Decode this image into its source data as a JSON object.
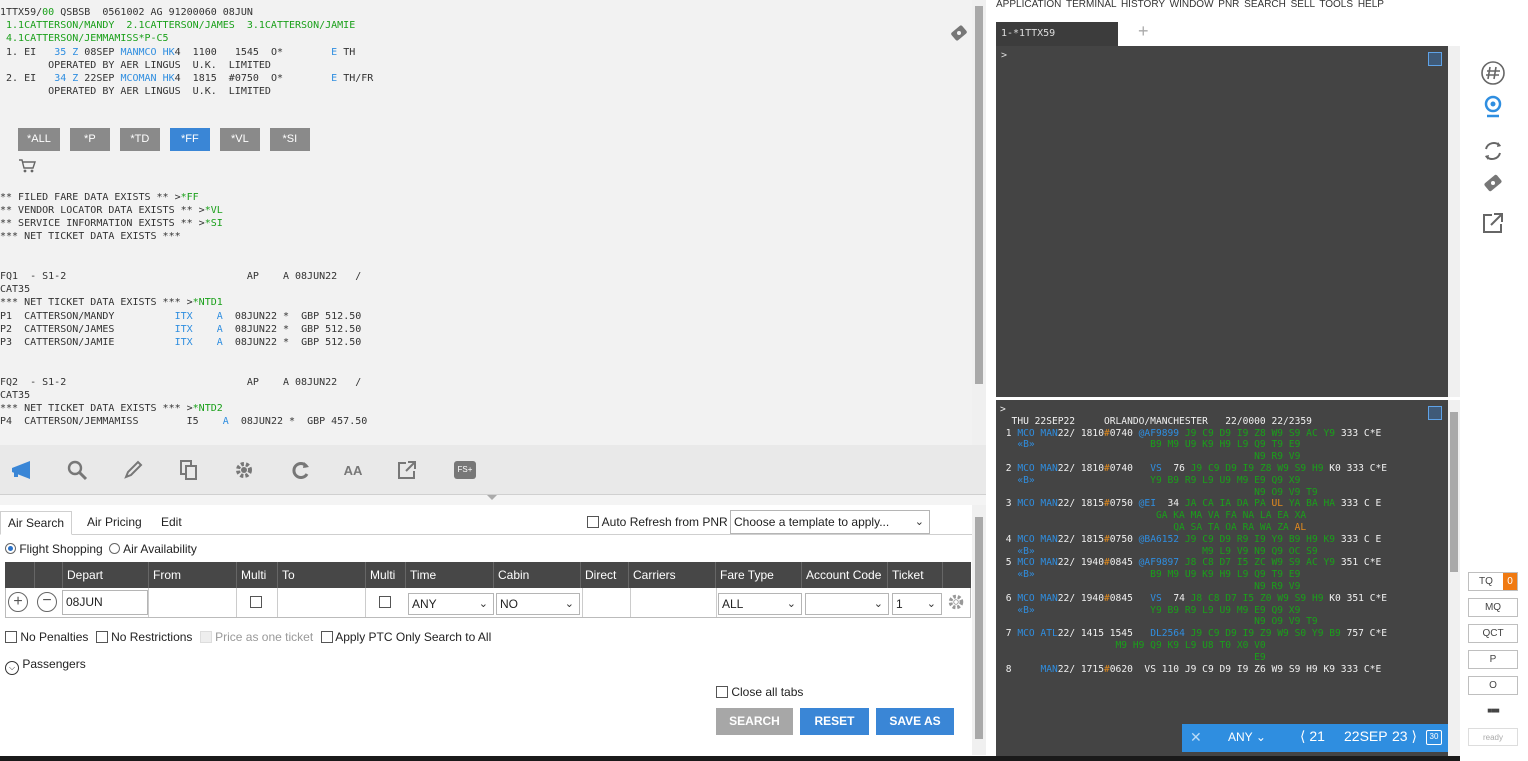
{
  "pnr": {
    "lines": [
      [
        [
          "1TTX59/",
          "d"
        ],
        [
          "00",
          "g"
        ],
        [
          " QSBSB  0561002 AG 91200060 08JUN",
          "d"
        ]
      ],
      [
        [
          " 1.1CATTERSON/MANDY  2.1CATTERSON/JAMES  3.1CATTERSON/JAMIE",
          "g"
        ]
      ],
      [
        [
          " 4.1CATTERSON/JEMMAMISS*P-C5",
          "g"
        ]
      ],
      [
        [
          " 1. EI   ",
          "d"
        ],
        [
          "35 Z",
          "b"
        ],
        [
          " 08SEP ",
          "d"
        ],
        [
          "MANMCO HK",
          "b"
        ],
        [
          "4  1100   1545  O*        ",
          "d"
        ],
        [
          "E",
          "b"
        ],
        [
          " TH",
          "d"
        ]
      ],
      [
        [
          "        OPERATED BY AER LINGUS  U.K.  LIMITED",
          "d"
        ]
      ],
      [
        [
          " 2. EI   ",
          "d"
        ],
        [
          "34 Z",
          "b"
        ],
        [
          " 22SEP ",
          "d"
        ],
        [
          "MCOMAN HK",
          "b"
        ],
        [
          "4  1815  #0750  O*        ",
          "d"
        ],
        [
          "E",
          "b"
        ],
        [
          " TH/FR",
          "d"
        ]
      ],
      [
        [
          "        OPERATED BY AER LINGUS  U.K.  LIMITED",
          "d"
        ]
      ],
      [
        [
          "",
          "d"
        ]
      ],
      [
        [
          "",
          "d"
        ]
      ],
      [
        [
          "",
          "d"
        ]
      ],
      [
        [
          "",
          "d"
        ]
      ],
      [
        [
          "",
          "d"
        ]
      ],
      [
        [
          "",
          "d"
        ]
      ],
      [
        [
          "",
          "d"
        ]
      ],
      [
        [
          "** FILED FARE DATA EXISTS ** >",
          "d"
        ],
        [
          "*FF",
          "g"
        ]
      ],
      [
        [
          "** VENDOR LOCATOR DATA EXISTS ** >",
          "d"
        ],
        [
          "*VL",
          "g"
        ]
      ],
      [
        [
          "** SERVICE INFORMATION EXISTS ** >",
          "d"
        ],
        [
          "*SI",
          "g"
        ]
      ],
      [
        [
          "*** NET TICKET DATA EXISTS ***",
          "d"
        ]
      ],
      [
        [
          "",
          "d"
        ]
      ],
      [
        [
          "",
          "d"
        ]
      ],
      [
        [
          "FQ1  - S1-2                              AP    A 08JUN22   /",
          "d"
        ]
      ],
      [
        [
          "CAT35",
          "d"
        ]
      ],
      [
        [
          "*** NET TICKET DATA EXISTS *** >",
          "d"
        ],
        [
          "*NTD1",
          "g"
        ]
      ],
      [
        [
          "P1  CATTERSON/MANDY          ",
          "d"
        ],
        [
          "ITX",
          "b"
        ],
        [
          "    ",
          "d"
        ],
        [
          "A",
          "b"
        ],
        [
          "  08JUN22 *  GBP 512.50",
          "d"
        ]
      ],
      [
        [
          "P2  CATTERSON/JAMES          ",
          "d"
        ],
        [
          "ITX",
          "b"
        ],
        [
          "    ",
          "d"
        ],
        [
          "A",
          "b"
        ],
        [
          "  08JUN22 *  GBP 512.50",
          "d"
        ]
      ],
      [
        [
          "P3  CATTERSON/JAMIE          ",
          "d"
        ],
        [
          "ITX",
          "b"
        ],
        [
          "    ",
          "d"
        ],
        [
          "A",
          "b"
        ],
        [
          "  08JUN22 *  GBP 512.50",
          "d"
        ]
      ],
      [
        [
          "",
          "d"
        ]
      ],
      [
        [
          "",
          "d"
        ]
      ],
      [
        [
          "FQ2  - S1-2                              AP    A 08JUN22   /",
          "d"
        ]
      ],
      [
        [
          "CAT35",
          "d"
        ]
      ],
      [
        [
          "*** NET TICKET DATA EXISTS *** >",
          "d"
        ],
        [
          "*NTD2",
          "g"
        ]
      ],
      [
        [
          "P4  CATTERSON/JEMMAMISS        I5    ",
          "d"
        ],
        [
          "A",
          "b"
        ],
        [
          "  08JUN22 *  GBP 457.50",
          "d"
        ]
      ]
    ],
    "shortcut_buttons": [
      {
        "label": "*ALL",
        "active": false
      },
      {
        "label": "*P",
        "active": false
      },
      {
        "label": "*TD",
        "active": false
      },
      {
        "label": "*FF",
        "active": true
      },
      {
        "label": "*VL",
        "active": false
      },
      {
        "label": "*SI",
        "active": false
      }
    ]
  },
  "toolbar": {
    "icons": [
      "megaphone-icon",
      "search-icon",
      "pencil-icon",
      "copy-icon",
      "gear-icon",
      "refresh-icon",
      "font-size-icon",
      "external-link-icon",
      "fs-icon"
    ],
    "aa_label": "AA",
    "fs_label": "FS+"
  },
  "form": {
    "tabs": [
      "Air Search",
      "Air Pricing",
      "Edit"
    ],
    "auto_refresh_label": "Auto Refresh from PNR",
    "template_placeholder": "Choose a template to apply...",
    "mode_flight_shopping": "Flight Shopping",
    "mode_air_availability": "Air Availability",
    "columns": [
      "Depart",
      "From",
      "Multi",
      "To",
      "Multi",
      "Time",
      "Cabin",
      "Direct",
      "Carriers",
      "Fare Type",
      "Account Code",
      "Ticket"
    ],
    "row": {
      "depart": "08JUN",
      "time": "ANY",
      "cabin": "NO",
      "fare_type": "ALL",
      "account_code": "",
      "ticket": "1"
    },
    "options": {
      "no_penalties": "No Penalties",
      "no_restrictions": "No Restrictions",
      "price_one_ticket": "Price as one ticket",
      "apply_ptc": "Apply PTC Only Search to All"
    },
    "passengers_label": "Passengers",
    "close_all_tabs": "Close all tabs",
    "search_btn": "SEARCH",
    "reset_btn": "RESET",
    "save_as_btn": "SAVE AS"
  },
  "right": {
    "menu": "APPLICATION  TERMINAL  HISTORY  WINDOW  PNR  SEARCH  SELL  TOOLS  HELP",
    "terminal_tab": "1-*1TTX59",
    "add_tab": "+",
    "prompt": ">",
    "availability_lines": [
      [
        [
          ">",
          "w"
        ]
      ],
      [
        [
          "  THU 22SEP22     ORLANDO/MANCHESTER   22/0000 22/2359",
          "w"
        ]
      ],
      [
        [
          " 1 ",
          "w"
        ],
        [
          "MCO MAN",
          "b"
        ],
        [
          "22/ 1810",
          "w"
        ],
        [
          "#",
          "o"
        ],
        [
          "0740 ",
          "w"
        ],
        [
          "@AF9899",
          "b"
        ],
        [
          " J9 C9 D9 I9 Z8 W9 S9 AC Y9 ",
          "g"
        ],
        [
          "333 C*E",
          "w"
        ]
      ],
      [
        [
          "   «B»",
          "b"
        ],
        [
          "                    B9 M9 U9 K9 H9 L9 Q9 T9 E9",
          "g"
        ]
      ],
      [
        [
          "                                            N9 R9 V9",
          "g"
        ]
      ],
      [
        [
          " 2 ",
          "w"
        ],
        [
          "MCO MAN",
          "b"
        ],
        [
          "22/ 1810",
          "w"
        ],
        [
          "#",
          "o"
        ],
        [
          "0740   ",
          "w"
        ],
        [
          "VS",
          "b"
        ],
        [
          "  76 ",
          "w"
        ],
        [
          "J9 C9 D9 I9 Z8 W9 S9 H9 ",
          "g"
        ],
        [
          "K0",
          "w"
        ],
        [
          " 333 C*E",
          "w"
        ]
      ],
      [
        [
          "   «B»",
          "b"
        ],
        [
          "                    Y9 B9 R9 L9 U9 M9 E9 Q9 X9",
          "g"
        ]
      ],
      [
        [
          "                                            N9 O9 V9 T9",
          "g"
        ]
      ],
      [
        [
          " 3 ",
          "w"
        ],
        [
          "MCO MAN",
          "b"
        ],
        [
          "22/ 1815",
          "w"
        ],
        [
          "#",
          "o"
        ],
        [
          "0750 ",
          "w"
        ],
        [
          "@EI",
          "b"
        ],
        [
          "  34 ",
          "w"
        ],
        [
          "JA CA IA DA PA ",
          "g"
        ],
        [
          "UL",
          "o"
        ],
        [
          " YA BA HA ",
          "g"
        ],
        [
          "333 C E",
          "w"
        ]
      ],
      [
        [
          "                           GA KA MA VA FA NA LA EA XA",
          "g"
        ]
      ],
      [
        [
          "                              QA SA TA OA RA WA ZA ",
          "g"
        ],
        [
          "AL",
          "o"
        ]
      ],
      [
        [
          " 4 ",
          "w"
        ],
        [
          "MCO MAN",
          "b"
        ],
        [
          "22/ 1815",
          "w"
        ],
        [
          "#",
          "o"
        ],
        [
          "0750 ",
          "w"
        ],
        [
          "@BA6152",
          "b"
        ],
        [
          " J9 C9 D9 R9 I9 Y9 B9 H9 K9 ",
          "g"
        ],
        [
          "333 C E",
          "w"
        ]
      ],
      [
        [
          "   «B»",
          "b"
        ],
        [
          "                             M9 L9 V9 N9 Q9 OC S9",
          "g"
        ]
      ],
      [
        [
          " 5 ",
          "w"
        ],
        [
          "MCO MAN",
          "b"
        ],
        [
          "22/ 1940",
          "w"
        ],
        [
          "#",
          "o"
        ],
        [
          "0845 ",
          "w"
        ],
        [
          "@AF9897",
          "b"
        ],
        [
          " J8 C8 D7 I5 ZC W9 S9 AC Y9 ",
          "g"
        ],
        [
          "351 C*E",
          "w"
        ]
      ],
      [
        [
          "   «B»",
          "b"
        ],
        [
          "                    B9 M9 U9 K9 H9 L9 Q9 T9 E9",
          "g"
        ]
      ],
      [
        [
          "                                            N9 R9 V9",
          "g"
        ]
      ],
      [
        [
          " 6 ",
          "w"
        ],
        [
          "MCO MAN",
          "b"
        ],
        [
          "22/ 1940",
          "w"
        ],
        [
          "#",
          "o"
        ],
        [
          "0845   ",
          "w"
        ],
        [
          "VS",
          "b"
        ],
        [
          "  74 ",
          "w"
        ],
        [
          "J8 C8 D7 I5 Z0 W9 S9 H9 ",
          "g"
        ],
        [
          "K0",
          "w"
        ],
        [
          " 351 C*E",
          "w"
        ]
      ],
      [
        [
          "   «B»",
          "b"
        ],
        [
          "                    Y9 B9 R9 L9 U9 M9 E9 Q9 X9",
          "g"
        ]
      ],
      [
        [
          "                                            N9 O9 V9 T9",
          "g"
        ]
      ],
      [
        [
          " 7 ",
          "w"
        ],
        [
          "MCO ATL",
          "b"
        ],
        [
          "22/ 1415 1545   ",
          "w"
        ],
        [
          "DL2564",
          "b"
        ],
        [
          " J9 C9 D9 I9 Z9 W9 S0 Y9 B9 ",
          "g"
        ],
        [
          "757 C*E",
          "w"
        ]
      ],
      [
        [
          "                    M9 H9 Q9 K9 L9 U8 T0 X0 V0",
          "g"
        ]
      ],
      [
        [
          "                                            E9",
          "g"
        ]
      ],
      [
        [
          " 8     ",
          "w"
        ],
        [
          "MAN",
          "b"
        ],
        [
          "22/ 1715",
          "w"
        ],
        [
          "#",
          "o"
        ],
        [
          "0620  VS 110 J9 C9 D9 I9 Z6 W9 S9 H9 K9 333 C*E",
          "w"
        ]
      ]
    ],
    "date_bar": {
      "filter": "ANY",
      "prev_day": "21",
      "date": "22SEP",
      "next_day": "23",
      "calendar_day": "30"
    },
    "side_buttons": [
      {
        "label": "TQ",
        "badge": "0"
      },
      {
        "label": "MQ"
      },
      {
        "label": "QCT"
      },
      {
        "label": "P"
      },
      {
        "label": "O"
      },
      {
        "label": "■■■"
      }
    ],
    "status": "ready"
  }
}
